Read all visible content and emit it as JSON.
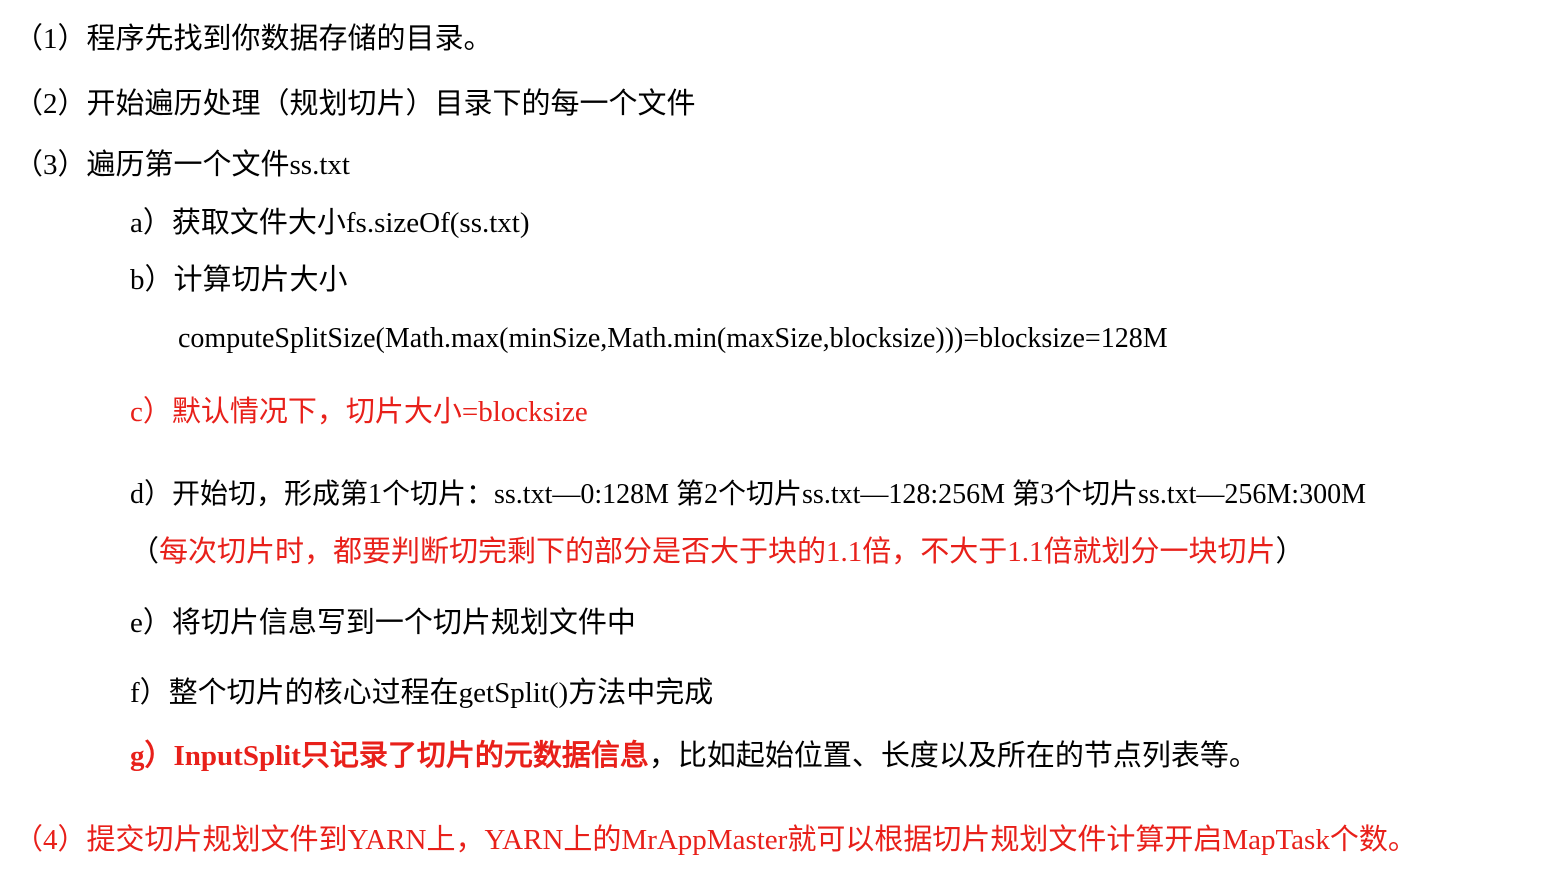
{
  "steps": [
    {
      "text": "（1）程序先找到你数据存储的目录。"
    },
    {
      "text": "（2）开始遍历处理（规划切片）目录下的每一个文件"
    },
    {
      "text": "（3）遍历第一个文件ss.txt"
    }
  ],
  "substeps": {
    "a": "a）获取文件大小fs.sizeOf(ss.txt)",
    "b": "b）计算切片大小",
    "b_formula": "computeSplitSize(Math.max(minSize,Math.min(maxSize,blocksize)))=blocksize=128M",
    "c": "c）默认情况下，切片大小=blocksize",
    "d": "d）开始切，形成第1个切片：ss.txt—0:128M 第2个切片ss.txt—128:256M 第3个切片ss.txt—256M:300M",
    "d_note_open": "（",
    "d_note": "每次切片时，都要判断切完剩下的部分是否大于块的1.1倍，不大于1.1倍就划分一块切片",
    "d_note_close": "）",
    "e": "e）将切片信息写到一个切片规划文件中",
    "f": "f）整个切片的核心过程在getSplit()方法中完成",
    "g_bold": "g）InputSplit只记录了切片的元数据信息",
    "g_rest": "，比如起始位置、长度以及所在的节点列表等。"
  },
  "step4": "（4）提交切片规划文件到YARN上，YARN上的MrAppMaster就可以根据切片规划文件计算开启MapTask个数。",
  "colors": {
    "text": "#000000",
    "highlight": "#e8201a"
  }
}
